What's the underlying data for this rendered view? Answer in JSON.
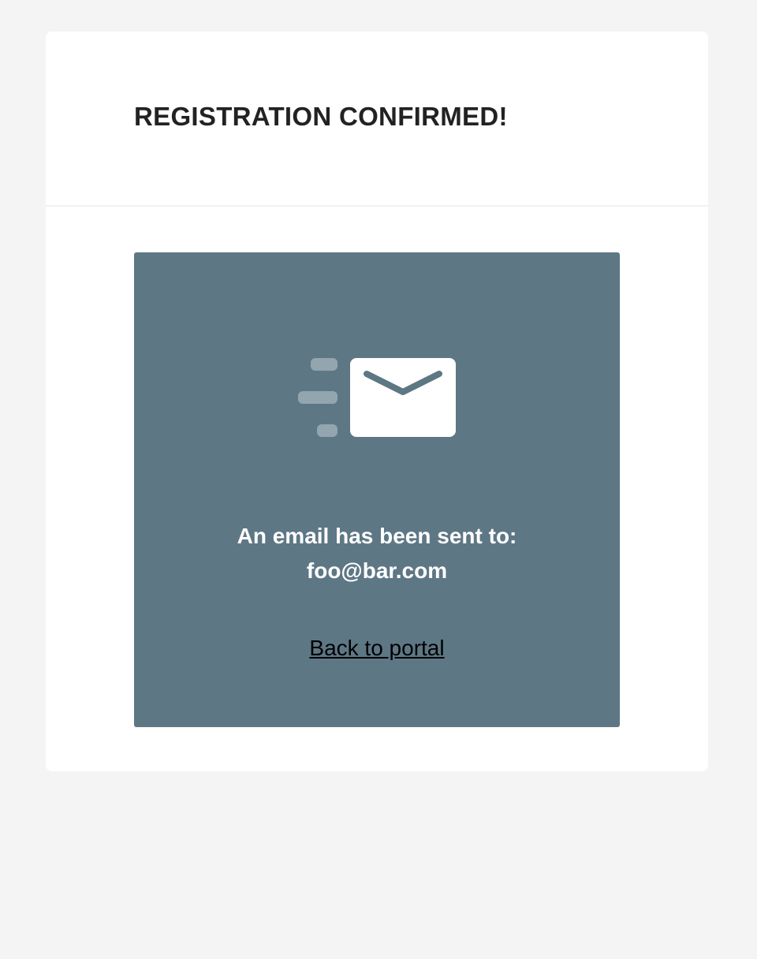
{
  "header": {
    "title": "REGISTRATION CONFIRMED!"
  },
  "confirmation": {
    "icon": "email-sent-icon",
    "message_line1": "An email has been sent to:",
    "email": "foo@bar.com",
    "back_link": "Back to portal"
  },
  "colors": {
    "page_background": "#f4f4f4",
    "panel_background": "#5e7785",
    "title_text": "#222222"
  }
}
